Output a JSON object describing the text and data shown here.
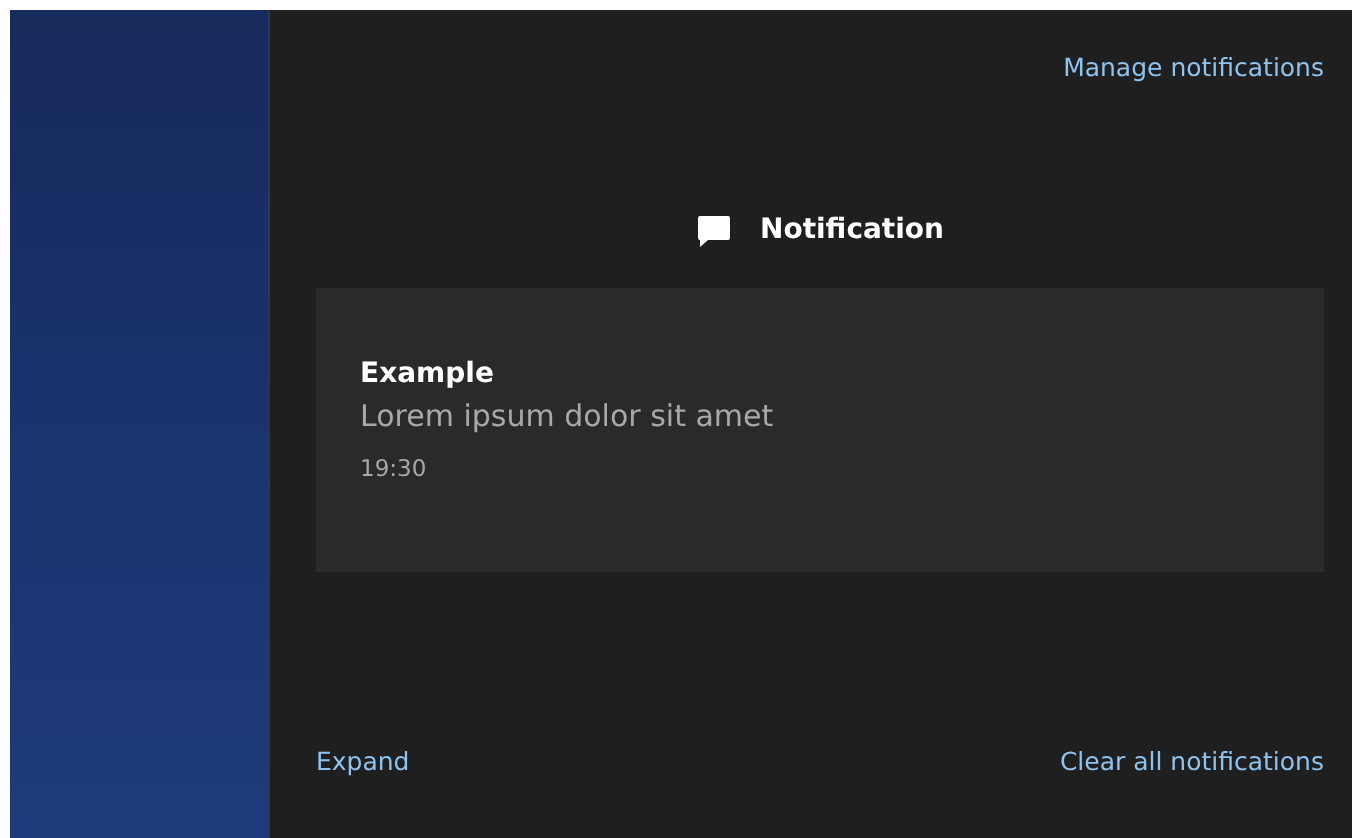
{
  "manage_link": "Manage notifications",
  "group": {
    "title": "Notification"
  },
  "notifications": [
    {
      "title": "Example",
      "body": "Lorem ipsum dolor sit amet",
      "time": "19:30"
    }
  ],
  "footer": {
    "expand": "Expand",
    "clear_all": "Clear all notifications"
  }
}
